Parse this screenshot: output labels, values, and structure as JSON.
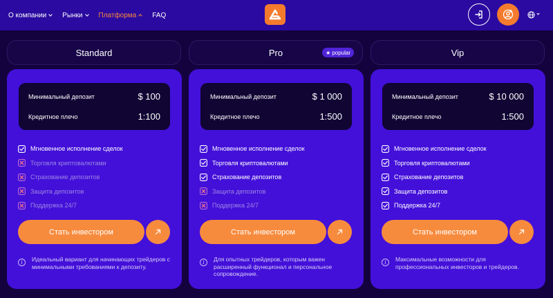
{
  "nav": {
    "links": [
      {
        "label": "О компании",
        "dropdown": true,
        "active": false
      },
      {
        "label": "Рынки",
        "dropdown": true,
        "active": false
      },
      {
        "label": "Платформа",
        "dropdown": true,
        "active": true
      },
      {
        "label": "FAQ",
        "dropdown": false,
        "active": false
      }
    ],
    "icons": {
      "logo": "logo-icon",
      "login": "login-icon",
      "profile": "user-add-icon",
      "language": "globe-icon"
    }
  },
  "colors": {
    "nav_bg": "#2a0aa0",
    "page_bg": "#14023f",
    "card_bg": "#4310d9",
    "accent": "#f78b3d",
    "active_link": "#ff8a3d"
  },
  "plans": [
    {
      "name": "Standard",
      "badge": "",
      "deposit_label": "Минимальный депозит",
      "deposit_value": "$ 100",
      "leverage_label": "Кредитное плечо",
      "leverage_value": "1:100",
      "features": [
        {
          "label": "Мгновенное исполнение сделок",
          "included": true
        },
        {
          "label": "Торговля криптовалютами",
          "included": false
        },
        {
          "label": "Страхование депозитов",
          "included": false
        },
        {
          "label": "Защита депозитов",
          "included": false
        },
        {
          "label": "Поддержка 24/7",
          "included": false
        }
      ],
      "cta": "Стать инвестором",
      "note": "Идеальный вариант для начинающих трейдеров с минимальными требованиями к депозиту."
    },
    {
      "name": "Pro",
      "badge": "popular",
      "deposit_label": "Минимальный депозит",
      "deposit_value": "$ 1 000",
      "leverage_label": "Кредитное плечо",
      "leverage_value": "1:500",
      "features": [
        {
          "label": "Мгновенное исполнение сделок",
          "included": true
        },
        {
          "label": "Торговля криптовалютами",
          "included": true
        },
        {
          "label": "Страхование депозитов",
          "included": true
        },
        {
          "label": "Защита депозитов",
          "included": false
        },
        {
          "label": "Поддержка 24/7",
          "included": false
        }
      ],
      "cta": "Стать инвестором",
      "note": "Для опытных трейдеров, которым важен расширенный функционал и персональное сопровождение."
    },
    {
      "name": "Vip",
      "badge": "",
      "deposit_label": "Минимальный депозит",
      "deposit_value": "$ 10 000",
      "leverage_label": "Кредитное плечо",
      "leverage_value": "1:500",
      "features": [
        {
          "label": "Мгновенное исполнение сделок",
          "included": true
        },
        {
          "label": "Торговля криптовалютами",
          "included": true
        },
        {
          "label": "Страхование депозитов",
          "included": true
        },
        {
          "label": "Защита депозитов",
          "included": true
        },
        {
          "label": "Поддержка 24/7",
          "included": true
        }
      ],
      "cta": "Стать инвестором",
      "note": "Максимальные возможности для профессиональных инвесторов и трейдеров."
    }
  ]
}
